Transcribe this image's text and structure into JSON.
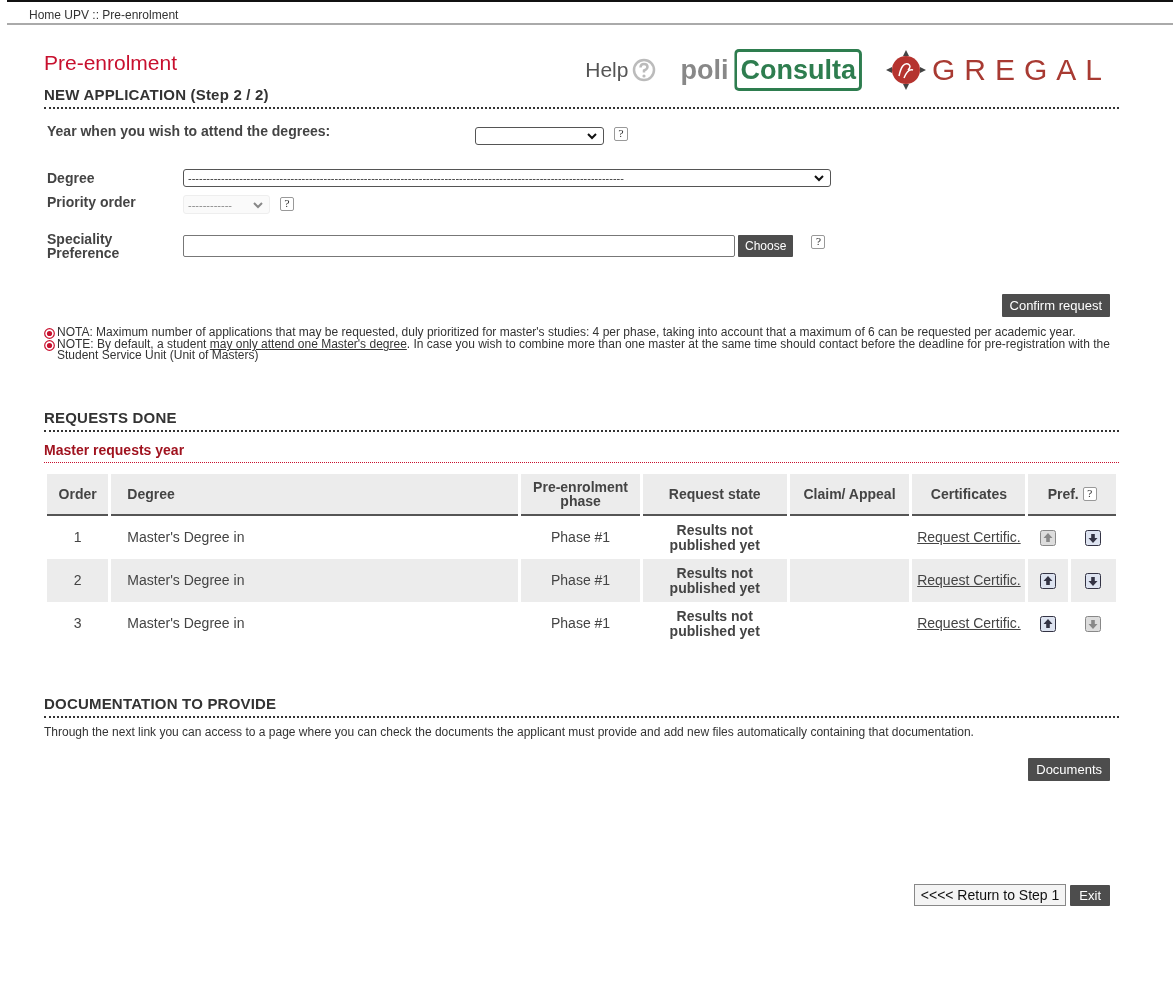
{
  "breadcrumb": "Home UPV :: Pre-enrolment",
  "page_title": "Pre-enrolment",
  "header": {
    "help": "Help",
    "logo_poli": "poli",
    "logo_consulta": "Consulta",
    "logo_gregal": "GREGAL"
  },
  "new_application": {
    "heading": "NEW APPLICATION (Step 2 / 2)",
    "year": {
      "label": "Year when you wish to attend the degrees:",
      "help_mark": "?"
    },
    "degree": {
      "label": "Degree",
      "value": "-----------------------------------------------------------------------------------------------------------------------"
    },
    "priority": {
      "label": "Priority order",
      "value": "------------",
      "disabled": true,
      "help_mark": "?"
    },
    "speciality": {
      "label": "Speciality Preference",
      "button": "Choose",
      "help_mark": "?"
    },
    "confirm": "Confirm request",
    "notes": [
      {
        "before": "NOTA: Maximum number of applications that may be requested, duly prioritized for master's studies: 4 per phase, taking into account that a maximum of 6 can be requested per academic year."
      },
      {
        "before": "NOTE: By default, a student ",
        "link": "may only attend one Master's degree",
        "after": ". In case you wish to combine more than one master at the same time should contact before the deadline for pre-registration with the Student Service Unit (Unit of Masters)"
      }
    ]
  },
  "requests_done": {
    "heading": "REQUESTS DONE",
    "subheading": "Master requests year",
    "table": {
      "pref_help_mark": "?",
      "columns": [
        "Order",
        "Degree",
        "Pre-enrolment phase",
        "Request state",
        "Claim/ Appeal",
        "Certificates",
        "Pref."
      ],
      "rows": [
        {
          "order": "1",
          "degree": "Master's Degree in",
          "phase": "Phase #1",
          "state": "Results not published yet",
          "certificate": "Request Certific.",
          "up_disabled": true,
          "down_disabled": false
        },
        {
          "order": "2",
          "degree": "Master's Degree in",
          "phase": "Phase #1",
          "state": "Results not published yet",
          "certificate": "Request Certific.",
          "up_disabled": false,
          "down_disabled": false
        },
        {
          "order": "3",
          "degree": "Master's Degree in",
          "phase": "Phase #1",
          "state": "Results not published yet",
          "certificate": "Request Certific.",
          "up_disabled": false,
          "down_disabled": true
        }
      ]
    }
  },
  "documentation": {
    "heading": "DOCUMENTATION TO PROVIDE",
    "text": "Through the next link you can access to a page where you can check the documents the applicant must provide and add new files automatically containing that documentation.",
    "button": "Documents"
  },
  "footer_buttons": {
    "return": "<<<< Return to Step 1",
    "exit": "Exit"
  }
}
